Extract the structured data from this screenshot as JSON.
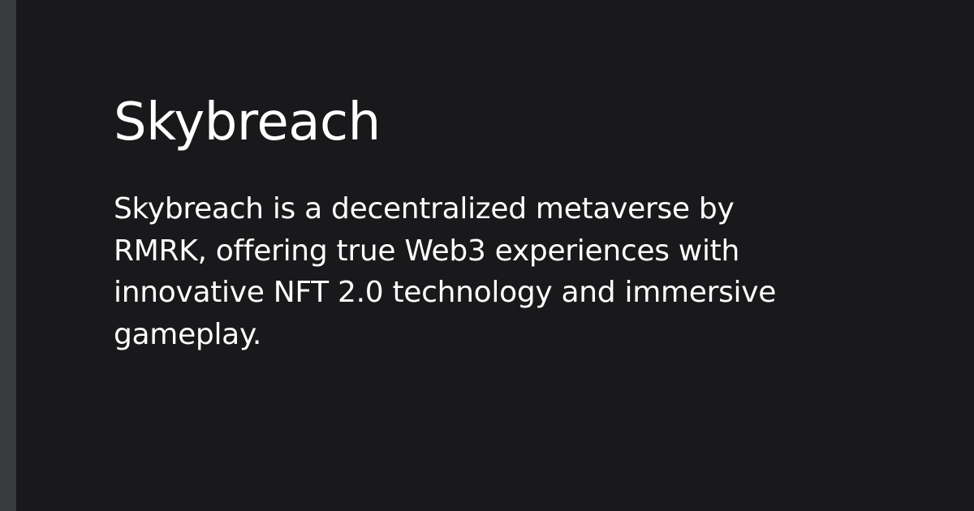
{
  "colors": {
    "background": "#19191b",
    "left_bar": "#3a3b3f",
    "text": "#ffffff"
  },
  "page": {
    "title": "Skybreach",
    "description": "Skybreach is a decentralized metaverse by RMRK, offering true Web3 experiences with innovative NFT 2.0 technology and immersive gameplay."
  }
}
